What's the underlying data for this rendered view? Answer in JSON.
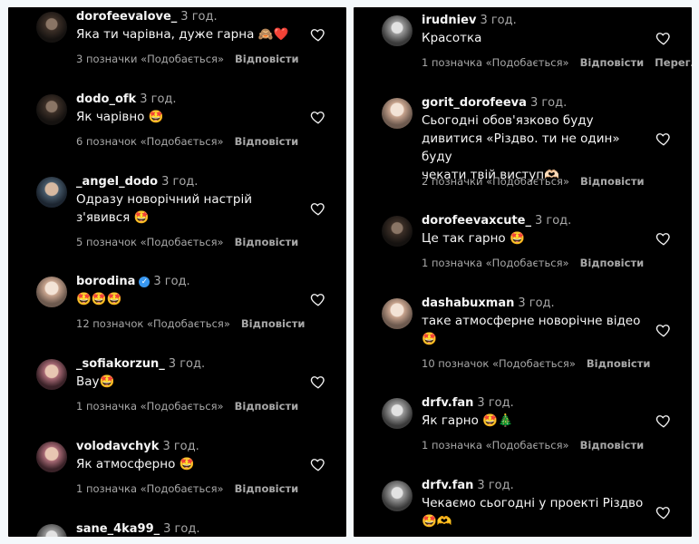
{
  "left_column": [
    {
      "username": "dorofeevalove_",
      "time": "3 год.",
      "text": "Яка ти чарівна, дуже гарна 🙈❤️",
      "likes": "3 позначки «Подобається»",
      "reply": "Відповісти",
      "extra": "",
      "verified": false,
      "avatar": "dark"
    },
    {
      "username": "dodo_ofk",
      "time": "3 год.",
      "text": "Як чарівно 🤩",
      "likes": "6 позначок «Подобається»",
      "reply": "Відповісти",
      "extra": "",
      "verified": false,
      "avatar": "dark"
    },
    {
      "username": "_angel_dodo",
      "time": "3 год.",
      "text": "Одразу новорічний настрій\nз'явився 🤩",
      "likes": "5 позначок «Подобається»",
      "reply": "Відповісти",
      "extra": "",
      "verified": false,
      "avatar": "blue"
    },
    {
      "username": "borodina",
      "time": "3 год.",
      "text": "🤩🤩🤩",
      "likes": "12 позначок «Подобається»",
      "reply": "Відповісти",
      "extra": "",
      "verified": true,
      "avatar": "light"
    },
    {
      "username": "_sofiakorzun_",
      "time": "3 год.",
      "text": "Вау🤩",
      "likes": "1 позначка «Подобається»",
      "reply": "Відповісти",
      "extra": "",
      "verified": false,
      "avatar": "pink"
    },
    {
      "username": "volodavchyk",
      "time": "3 год.",
      "text": "Як атмосферно 🤩",
      "likes": "1 позначка «Подобається»",
      "reply": "Відповісти",
      "extra": "",
      "verified": false,
      "avatar": "pink"
    },
    {
      "username": "sane_4ka99_",
      "time": "3 год.",
      "text": "",
      "likes": "",
      "reply": "",
      "extra": "",
      "verified": false,
      "avatar": "gray"
    }
  ],
  "right_column": [
    {
      "username": "irudniev",
      "time": "3 год.",
      "text": "Красотка",
      "likes": "1 позначка «Подобається»",
      "reply": "Відповісти",
      "extra": "Переглян",
      "verified": false,
      "avatar": "gray"
    },
    {
      "username": "gorit_dorofeeva",
      "time": "3 год.",
      "text": "Сьогодні обов'язково буду\nдивитися «Різдво. ти не один» буду\nчекати твій виступ🫶🏻",
      "likes": "2 позначки «Подобається»",
      "reply": "Відповісти",
      "extra": "",
      "verified": false,
      "avatar": "light"
    },
    {
      "username": "dorofeevaxcute_",
      "time": "3 год.",
      "text": "Це так гарно 🤩",
      "likes": "1 позначка «Подобається»",
      "reply": "Відповісти",
      "extra": "",
      "verified": false,
      "avatar": "dark"
    },
    {
      "username": "dashabuxman",
      "time": "3 год.",
      "text": "таке атмосферне новорічне відео\n🤩",
      "likes": "10 позначок «Подобається»",
      "reply": "Відповісти",
      "extra": "",
      "verified": false,
      "avatar": "light"
    },
    {
      "username": "drfv.fan",
      "time": "3 год.",
      "text": "Як гарно 🤩🎄",
      "likes": "1 позначка «Подобається»",
      "reply": "Відповісти",
      "extra": "",
      "verified": false,
      "avatar": "gray"
    },
    {
      "username": "drfv.fan",
      "time": "3 год.",
      "text": "Чекаємо сьогодні у проекті Різдво\n🤩🫶",
      "likes": "",
      "reply": "",
      "extra": "",
      "verified": false,
      "avatar": "gray"
    }
  ]
}
